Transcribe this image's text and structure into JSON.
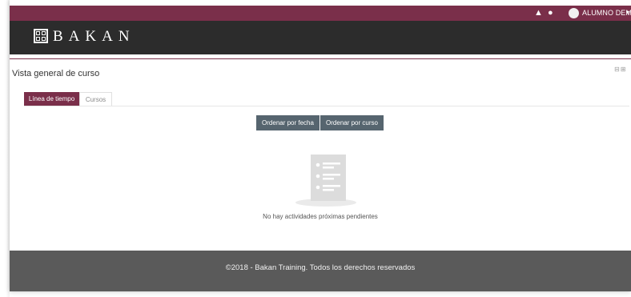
{
  "topbar": {
    "user_name": "ALUMNO DEMO",
    "bell_icon": "bell-icon",
    "chat_icon": "comments-icon",
    "bell_glyph": "▲",
    "chat_glyph": "●",
    "caret_glyph": "▾",
    "color": "#7a2f4a"
  },
  "brand": {
    "name": "BAKAN",
    "header_color": "#2c2c2c"
  },
  "block": {
    "title": "Vista general de curso",
    "controls_glyph": "⊟⊞",
    "tabs": [
      {
        "label": "Línea de tiempo",
        "active": true
      },
      {
        "label": "Cursos",
        "active": false
      }
    ],
    "sort_buttons": [
      {
        "label": "Ordenar por fecha"
      },
      {
        "label": "Ordenar por curso"
      }
    ],
    "empty_message": "No hay actividades próximas pendientes"
  },
  "footer": {
    "text": "©2018 - Bakan Training. Todos los derechos reservados",
    "color": "#5a5a5a"
  },
  "colors": {
    "accent": "#7a2f4a",
    "button": "#56656f"
  }
}
